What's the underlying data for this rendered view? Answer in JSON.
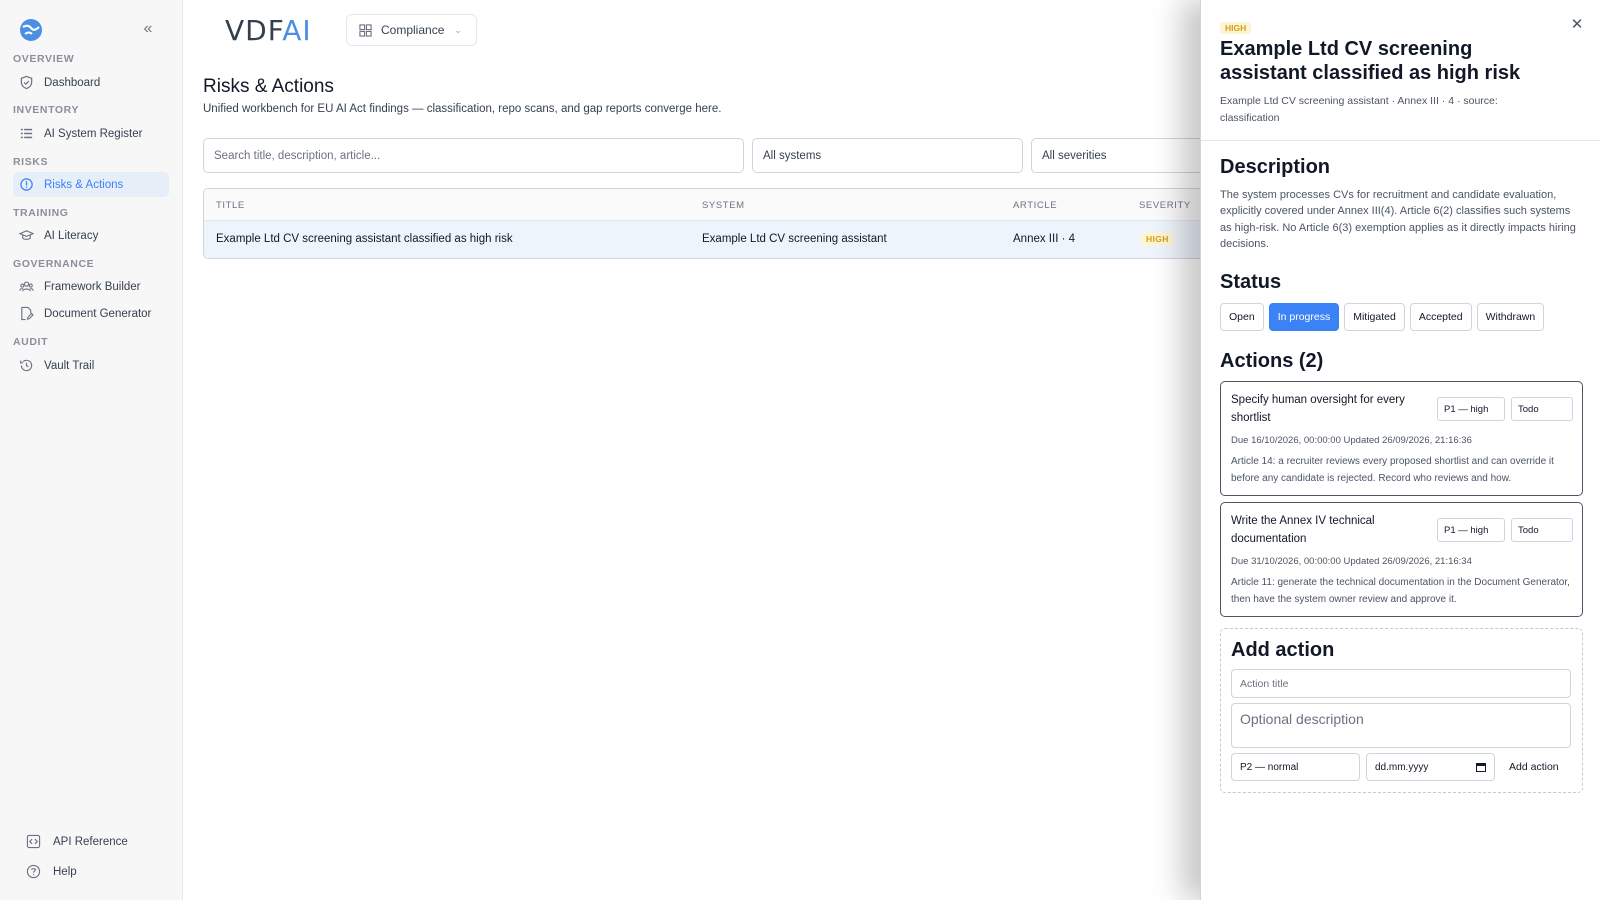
{
  "sidebar": {
    "collapse_icon": "double-chevron-left-icon",
    "sections": [
      {
        "label": "OVERVIEW"
      },
      {
        "label": "INVENTORY"
      },
      {
        "label": "RISKS"
      },
      {
        "label": "TRAINING"
      },
      {
        "label": "GOVERNANCE"
      },
      {
        "label": "AUDIT"
      }
    ],
    "items": [
      {
        "label": "Dashboard",
        "icon": "shield-icon"
      },
      {
        "label": "AI System Register",
        "icon": "list-icon"
      },
      {
        "label": "Risks & Actions",
        "icon": "alert-circle-icon",
        "active": true
      },
      {
        "label": "AI Literacy",
        "icon": "graduation-cap-icon"
      },
      {
        "label": "Framework Builder",
        "icon": "users-icon"
      },
      {
        "label": "Document Generator",
        "icon": "file-edit-icon"
      },
      {
        "label": "Vault Trail",
        "icon": "history-icon"
      }
    ],
    "bottom": [
      {
        "label": "API Reference",
        "icon": "code-icon"
      },
      {
        "label": "Help",
        "icon": "help-circle-icon"
      }
    ]
  },
  "header": {
    "brand_left": "VDF",
    "brand_right": "AI",
    "workspace": "Compliance"
  },
  "main": {
    "title": "Risks & Actions",
    "subtitle": "Unified workbench for EU AI Act findings — classification, repo scans, and gap reports converge here.",
    "search_placeholder": "Search title, description, article...",
    "filter_system": "All systems",
    "filter_severity": "All severities",
    "table": {
      "columns": [
        "TITLE",
        "SYSTEM",
        "ARTICLE",
        "SEVERITY"
      ],
      "rows": [
        {
          "title": "Example Ltd CV screening assistant classified as high risk",
          "system": "Example Ltd CV screening assistant",
          "article": "Annex III · 4",
          "severity": "HIGH"
        }
      ]
    }
  },
  "drawer": {
    "severity": "HIGH",
    "title": "Example Ltd CV screening assistant classified as high risk",
    "meta": "Example Ltd CV screening assistant · Annex III · 4 · source: classification",
    "description_heading": "Description",
    "description": "The system processes CVs for recruitment and candidate evaluation, explicitly covered under Annex III(4). Article 6(2) classifies such systems as high-risk. No Article 6(3) exemption applies as it directly impacts hiring decisions.",
    "status_heading": "Status",
    "statuses": [
      "Open",
      "In progress",
      "Mitigated",
      "Accepted",
      "Withdrawn"
    ],
    "active_status": "In progress",
    "actions_heading": "Actions (2)",
    "actions": [
      {
        "title": "Specify human oversight for every shortlist",
        "priority": "P1 — high",
        "state": "Todo",
        "dates": "Due 16/10/2026, 00:00:00   Updated 26/09/2026, 21:16:36",
        "description": "Article 14: a recruiter reviews every proposed shortlist and can override it before any candidate is rejected. Record who reviews and how."
      },
      {
        "title": "Write the Annex IV technical documentation",
        "priority": "P1 — high",
        "state": "Todo",
        "dates": "Due 31/10/2026, 00:00:00   Updated 26/09/2026, 21:16:34",
        "description": "Article 11: generate the technical documentation in the Document Generator, then have the system owner review and approve it."
      }
    ],
    "add_action": {
      "heading": "Add action",
      "title_placeholder": "Action title",
      "description_placeholder": "Optional description",
      "priority": "P2 — normal",
      "date_placeholder": "dd.mm.yyyy",
      "button": "Add action"
    }
  },
  "colors": {
    "accent": "#3b82f6",
    "badge_bg": "#fdf4d6",
    "badge_text": "#d4a012",
    "sidebar_bg": "#f7f7f8"
  }
}
